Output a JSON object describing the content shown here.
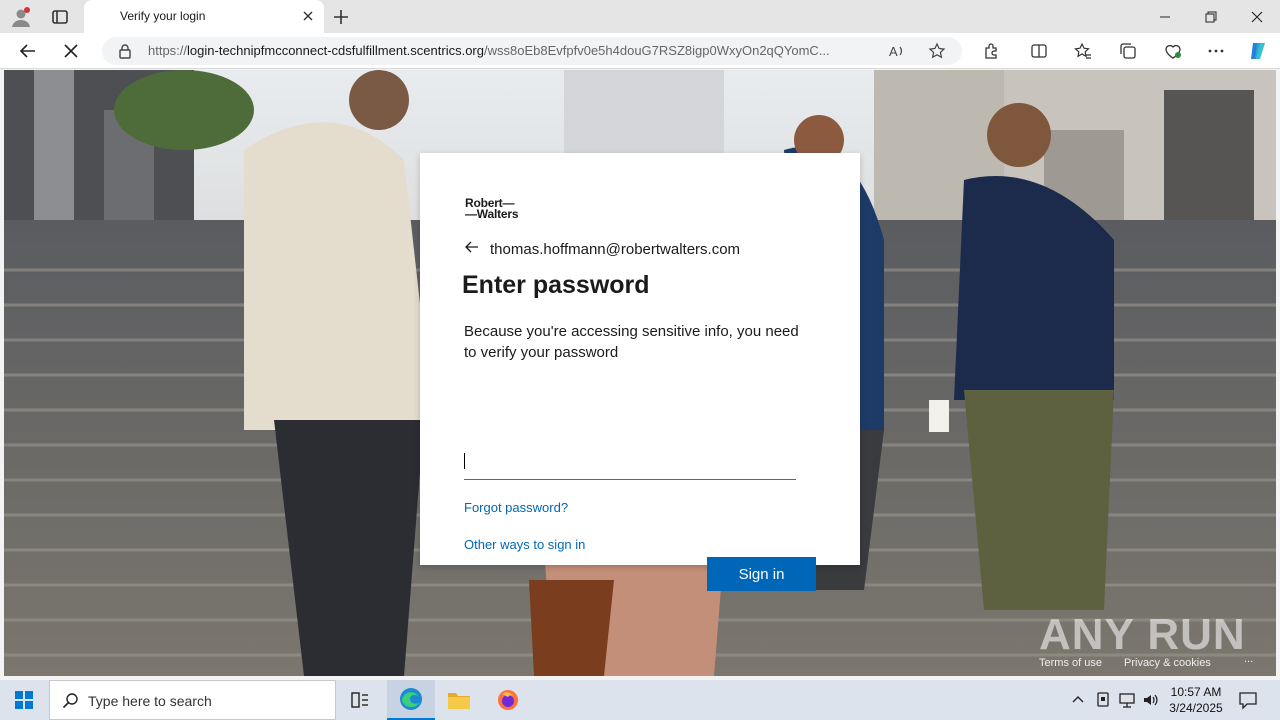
{
  "browser": {
    "tab_title": "Verify your login",
    "url_prefix": "https://",
    "url_host": "login-technipfmcconnect-cdsfulfillment.scentrics.org",
    "url_path": "/wss8oEb8Evfpfv0e5h4douG7RSZ8igp0WxyOn2qQYomC..."
  },
  "login": {
    "logo_line1": "Robert—",
    "logo_line2": "—Walters",
    "email": "thomas.hoffmann@robertwalters.com",
    "title": "Enter password",
    "description": "Because you're accessing sensitive info, you need to verify your password",
    "password_value": "",
    "forgot_link": "Forgot password?",
    "other_ways_link": "Other ways to sign in",
    "signin_label": "Sign in"
  },
  "page_footer": {
    "terms": "Terms of use",
    "privacy": "Privacy & cookies",
    "more": "..."
  },
  "watermark": "ANY RUN",
  "taskbar": {
    "search_placeholder": "Type here to search",
    "time": "10:57 AM",
    "date": "3/24/2025"
  },
  "colors": {
    "accent": "#0067b8",
    "taskbar": "#dde3ec"
  }
}
